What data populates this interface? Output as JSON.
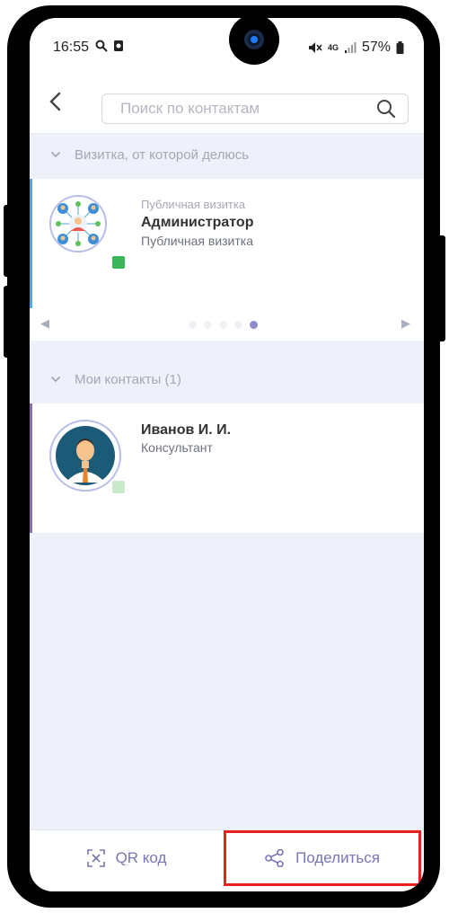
{
  "status_bar": {
    "time": "16:55",
    "network": "4G",
    "battery": "57%"
  },
  "header": {
    "search_placeholder": "Поиск по контактам"
  },
  "section_card": {
    "title": "Визитка, от которой делюсь"
  },
  "business_card": {
    "subtitle": "Публичная визитка",
    "name": "Администратор",
    "role": "Публичная визитка",
    "status_color": "#3bb55c"
  },
  "pager": {
    "left_arrow": "◀",
    "right_arrow": "▶",
    "total": 5,
    "active_index": 4
  },
  "section_contacts": {
    "title": "Мои контакты (1)"
  },
  "contact": {
    "name": "Иванов И. И.",
    "role": "Консультант",
    "status_color": "#c9e8cc"
  },
  "bottom_bar": {
    "qr_label": "QR код",
    "share_label": "Поделиться"
  },
  "colors": {
    "accent": "#7a75b3",
    "card_accent_blue": "#4aa8e8",
    "card_accent_purple": "#8a6fb0",
    "highlight_red": "#e8201e"
  }
}
